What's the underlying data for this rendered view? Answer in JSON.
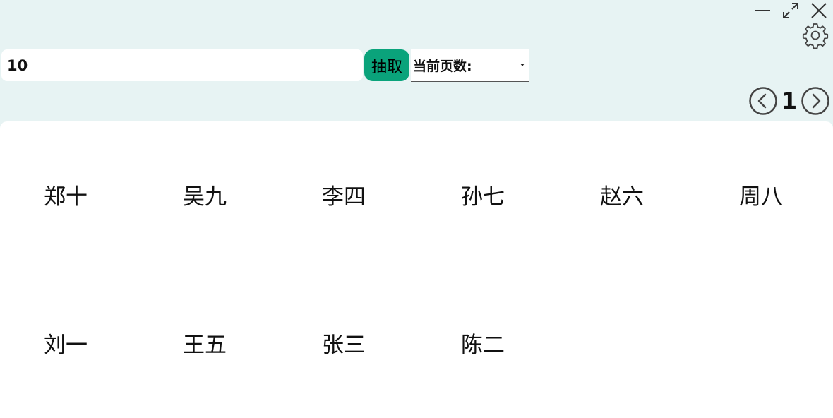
{
  "toolbar": {
    "count_value": "10",
    "draw_label": "抽取",
    "page_select_label": "当前页数:"
  },
  "pager": {
    "current_page": "1"
  },
  "results": [
    "郑十",
    "吴九",
    "李四",
    "孙七",
    "赵六",
    "周八",
    "刘一",
    "王五",
    "张三",
    "陈二"
  ],
  "icons": {
    "minimize": "minimize-icon",
    "maximize": "maximize-icon",
    "close": "close-icon",
    "settings": "gear-icon",
    "prev": "chevron-left-circle-icon",
    "next": "chevron-right-circle-icon"
  },
  "colors": {
    "background": "#e7f3f3",
    "accent": "#0aa37b",
    "panel": "#ffffff"
  }
}
